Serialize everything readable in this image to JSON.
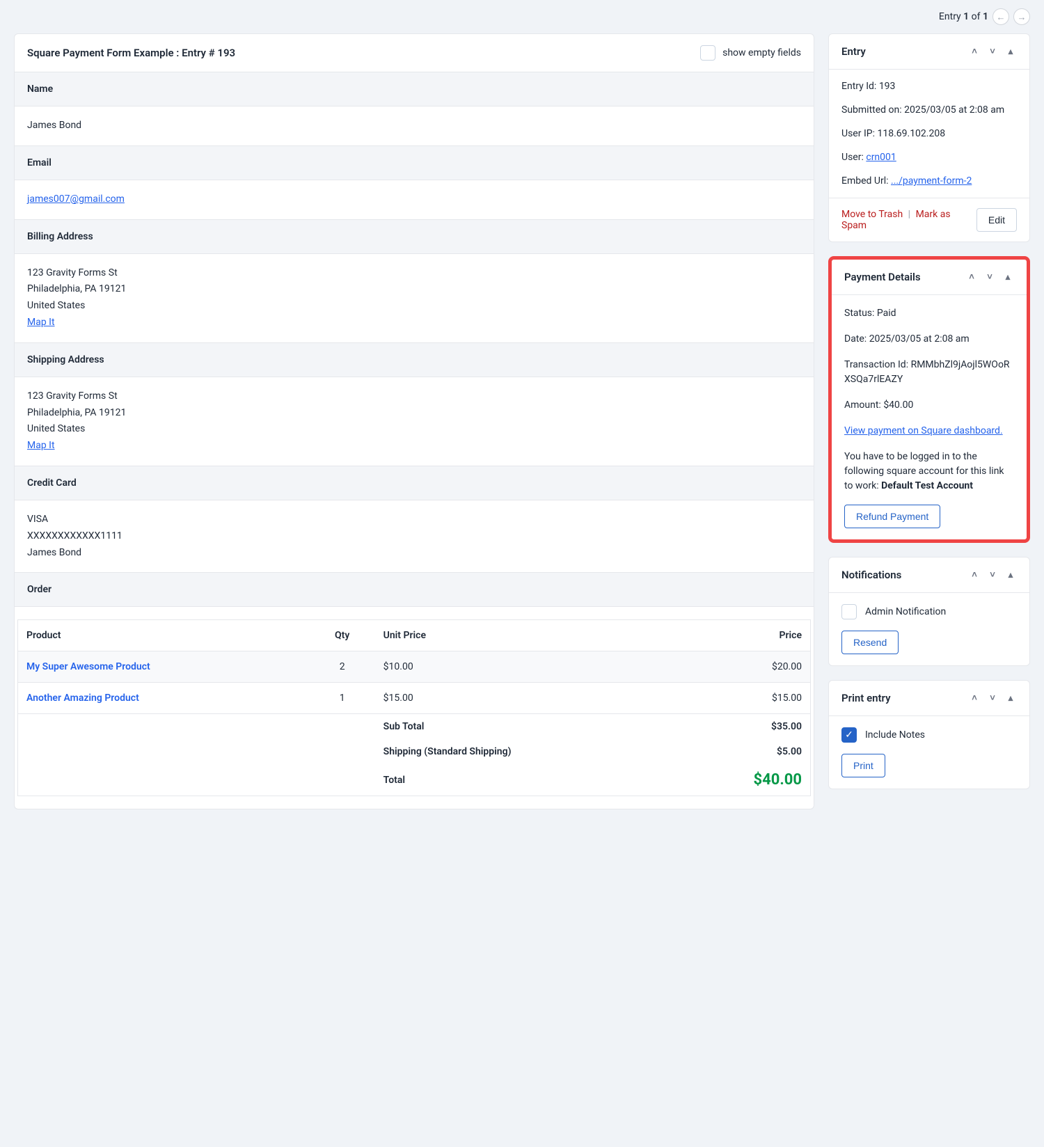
{
  "nav": {
    "entry_label": "Entry",
    "current": "1",
    "of_label": "of",
    "total": "1"
  },
  "entry_card": {
    "title": "Square Payment Form Example : Entry # 193",
    "show_empty_label": "show empty fields"
  },
  "fields": {
    "name_label": "Name",
    "name_value": "James Bond",
    "email_label": "Email",
    "email_value": "james007@gmail.com",
    "billing_label": "Billing Address",
    "billing_line1": "123 Gravity Forms St",
    "billing_line2": "Philadelphia, PA 19121",
    "billing_line3": "United States",
    "map_it": "Map It",
    "shipping_label": "Shipping Address",
    "shipping_line1": "123 Gravity Forms St",
    "shipping_line2": "Philadelphia, PA 19121",
    "shipping_line3": "United States",
    "cc_label": "Credit Card",
    "cc_line1": "VISA",
    "cc_line2": "XXXXXXXXXXXX1111",
    "cc_line3": "James Bond",
    "order_label": "Order"
  },
  "order": {
    "col_product": "Product",
    "col_qty": "Qty",
    "col_unit": "Unit Price",
    "col_price": "Price",
    "rows": [
      {
        "name": "My Super Awesome Product",
        "qty": "2",
        "unit": "$10.00",
        "price": "$20.00"
      },
      {
        "name": "Another Amazing Product",
        "qty": "1",
        "unit": "$15.00",
        "price": "$15.00"
      }
    ],
    "subtotal_label": "Sub Total",
    "subtotal_value": "$35.00",
    "shipping_label": "Shipping (Standard Shipping)",
    "shipping_value": "$5.00",
    "total_label": "Total",
    "total_value": "$40.00"
  },
  "entry_meta": {
    "title": "Entry",
    "id_label": "Entry Id:",
    "id_value": "193",
    "submitted_label": "Submitted on:",
    "submitted_value": "2025/03/05 at 2:08 am",
    "ip_label": "User IP:",
    "ip_value": "118.69.102.208",
    "user_label": "User:",
    "user_value": "crn001",
    "embed_label": "Embed Url:",
    "embed_value": ".../payment-form-2",
    "trash_label": "Move to Trash",
    "spam_label": "Mark as Spam",
    "edit_label": "Edit"
  },
  "payment": {
    "title": "Payment Details",
    "status_label": "Status:",
    "status_value": "Paid",
    "date_label": "Date:",
    "date_value": "2025/03/05 at 2:08 am",
    "txn_label": "Transaction Id:",
    "txn_value": "RMMbhZl9jAojl5WOoRXSQa7rlEAZY",
    "amount_label": "Amount:",
    "amount_value": "$40.00",
    "view_link": "View payment on Square dashboard.",
    "note_prefix": "You have to be logged in to the following square account for this link to work: ",
    "note_account": "Default Test Account",
    "refund_label": "Refund Payment"
  },
  "notifications": {
    "title": "Notifications",
    "admin_label": "Admin Notification",
    "resend_label": "Resend"
  },
  "print": {
    "title": "Print entry",
    "include_label": "Include Notes",
    "print_label": "Print"
  }
}
